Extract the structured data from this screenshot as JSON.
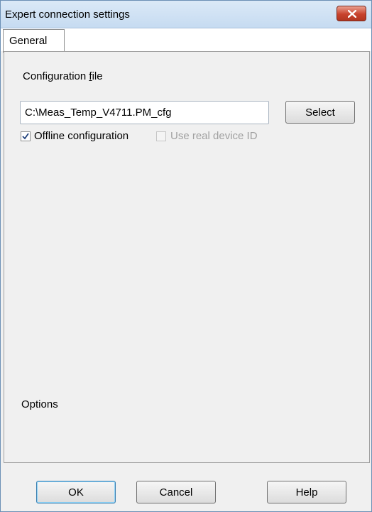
{
  "window": {
    "title": "Expert connection settings"
  },
  "tabs": [
    {
      "label": "General"
    }
  ],
  "general": {
    "config_label_prefix": "Configuration ",
    "config_label_accel": "f",
    "config_label_suffix": "ile",
    "config_file_value": "C:\\Meas_Temp_V4711.PM_cfg",
    "select_label": "Select",
    "offline_label": "Offline configuration",
    "offline_checked": true,
    "real_device_label": "Use real device ID",
    "real_device_checked": false,
    "real_device_enabled": false,
    "options_label": "Options"
  },
  "footer": {
    "ok_label": "OK",
    "cancel_label": "Cancel",
    "help_label": "Help"
  },
  "icons": {
    "close": "close-icon",
    "check": "check-icon"
  }
}
